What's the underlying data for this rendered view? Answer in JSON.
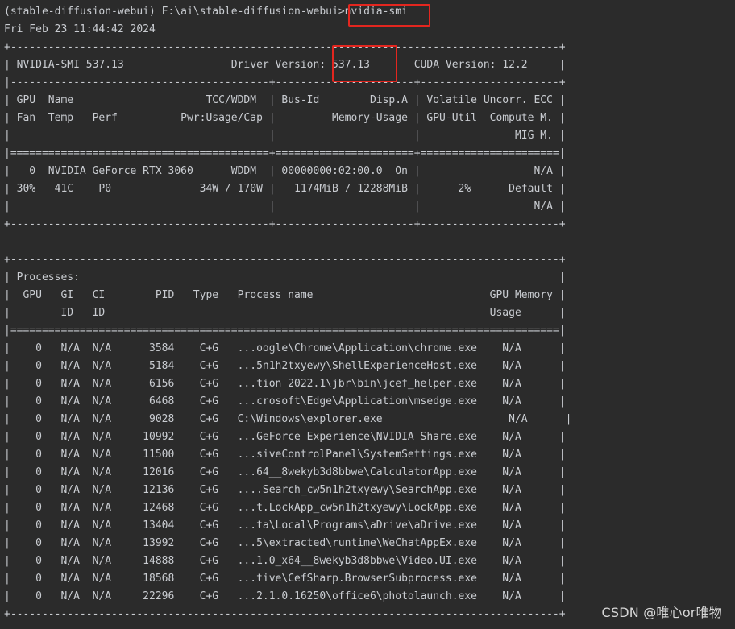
{
  "terminal": {
    "lines": [
      "(stable-diffusion-webui) F:\\ai\\stable-diffusion-webui>nvidia-smi",
      "Fri Feb 23 11:44:42 2024",
      "+---------------------------------------------------------------------------------------+",
      "| NVIDIA-SMI 537.13                 Driver Version: 537.13       CUDA Version: 12.2     |",
      "|-----------------------------------------+----------------------+----------------------+",
      "| GPU  Name                     TCC/WDDM  | Bus-Id        Disp.A | Volatile Uncorr. ECC |",
      "| Fan  Temp   Perf          Pwr:Usage/Cap |         Memory-Usage | GPU-Util  Compute M. |",
      "|                                         |                      |               MIG M. |",
      "|=========================================+======================+======================|",
      "|   0  NVIDIA GeForce RTX 3060      WDDM  | 00000000:02:00.0  On |                  N/A |",
      "| 30%   41C    P0              34W / 170W |   1174MiB / 12288MiB |      2%      Default |",
      "|                                         |                      |                  N/A |",
      "+-----------------------------------------+----------------------+----------------------+",
      "",
      "+---------------------------------------------------------------------------------------+",
      "| Processes:                                                                            |",
      "|  GPU   GI   CI        PID   Type   Process name                            GPU Memory |",
      "|        ID   ID                                                             Usage      |",
      "|=======================================================================================|",
      "|    0   N/A  N/A      3584    C+G   ...oogle\\Chrome\\Application\\chrome.exe    N/A      |",
      "|    0   N/A  N/A      5184    C+G   ...5n1h2txyewy\\ShellExperienceHost.exe    N/A      |",
      "|    0   N/A  N/A      6156    C+G   ...tion 2022.1\\jbr\\bin\\jcef_helper.exe    N/A      |",
      "|    0   N/A  N/A      6468    C+G   ...crosoft\\Edge\\Application\\msedge.exe    N/A      |",
      "|    0   N/A  N/A      9028    C+G   C:\\Windows\\explorer.exe                    N/A      |",
      "|    0   N/A  N/A     10992    C+G   ...GeForce Experience\\NVIDIA Share.exe    N/A      |",
      "|    0   N/A  N/A     11500    C+G   ...siveControlPanel\\SystemSettings.exe    N/A      |",
      "|    0   N/A  N/A     12016    C+G   ...64__8wekyb3d8bbwe\\CalculatorApp.exe    N/A      |",
      "|    0   N/A  N/A     12136    C+G   ....Search_cw5n1h2txyewy\\SearchApp.exe    N/A      |",
      "|    0   N/A  N/A     12468    C+G   ...t.LockApp_cw5n1h2txyewy\\LockApp.exe    N/A      |",
      "|    0   N/A  N/A     13404    C+G   ...ta\\Local\\Programs\\aDrive\\aDrive.exe    N/A      |",
      "|    0   N/A  N/A     13992    C+G   ...5\\extracted\\runtime\\WeChatAppEx.exe    N/A      |",
      "|    0   N/A  N/A     14888    C+G   ...1.0_x64__8wekyb3d8bbwe\\Video.UI.exe    N/A      |",
      "|    0   N/A  N/A     18568    C+G   ...tive\\CefSharp.BrowserSubprocess.exe    N/A      |",
      "|    0   N/A  N/A     22296    C+G   ...2.1.0.16250\\office6\\photolaunch.exe    N/A      |",
      "+---------------------------------------------------------------------------------------+"
    ]
  },
  "watermark": {
    "text": "CSDN @唯心or唯物"
  },
  "colors": {
    "background": "#2b2b2b",
    "text": "#c9ccd1",
    "highlight": "#e3261f"
  }
}
